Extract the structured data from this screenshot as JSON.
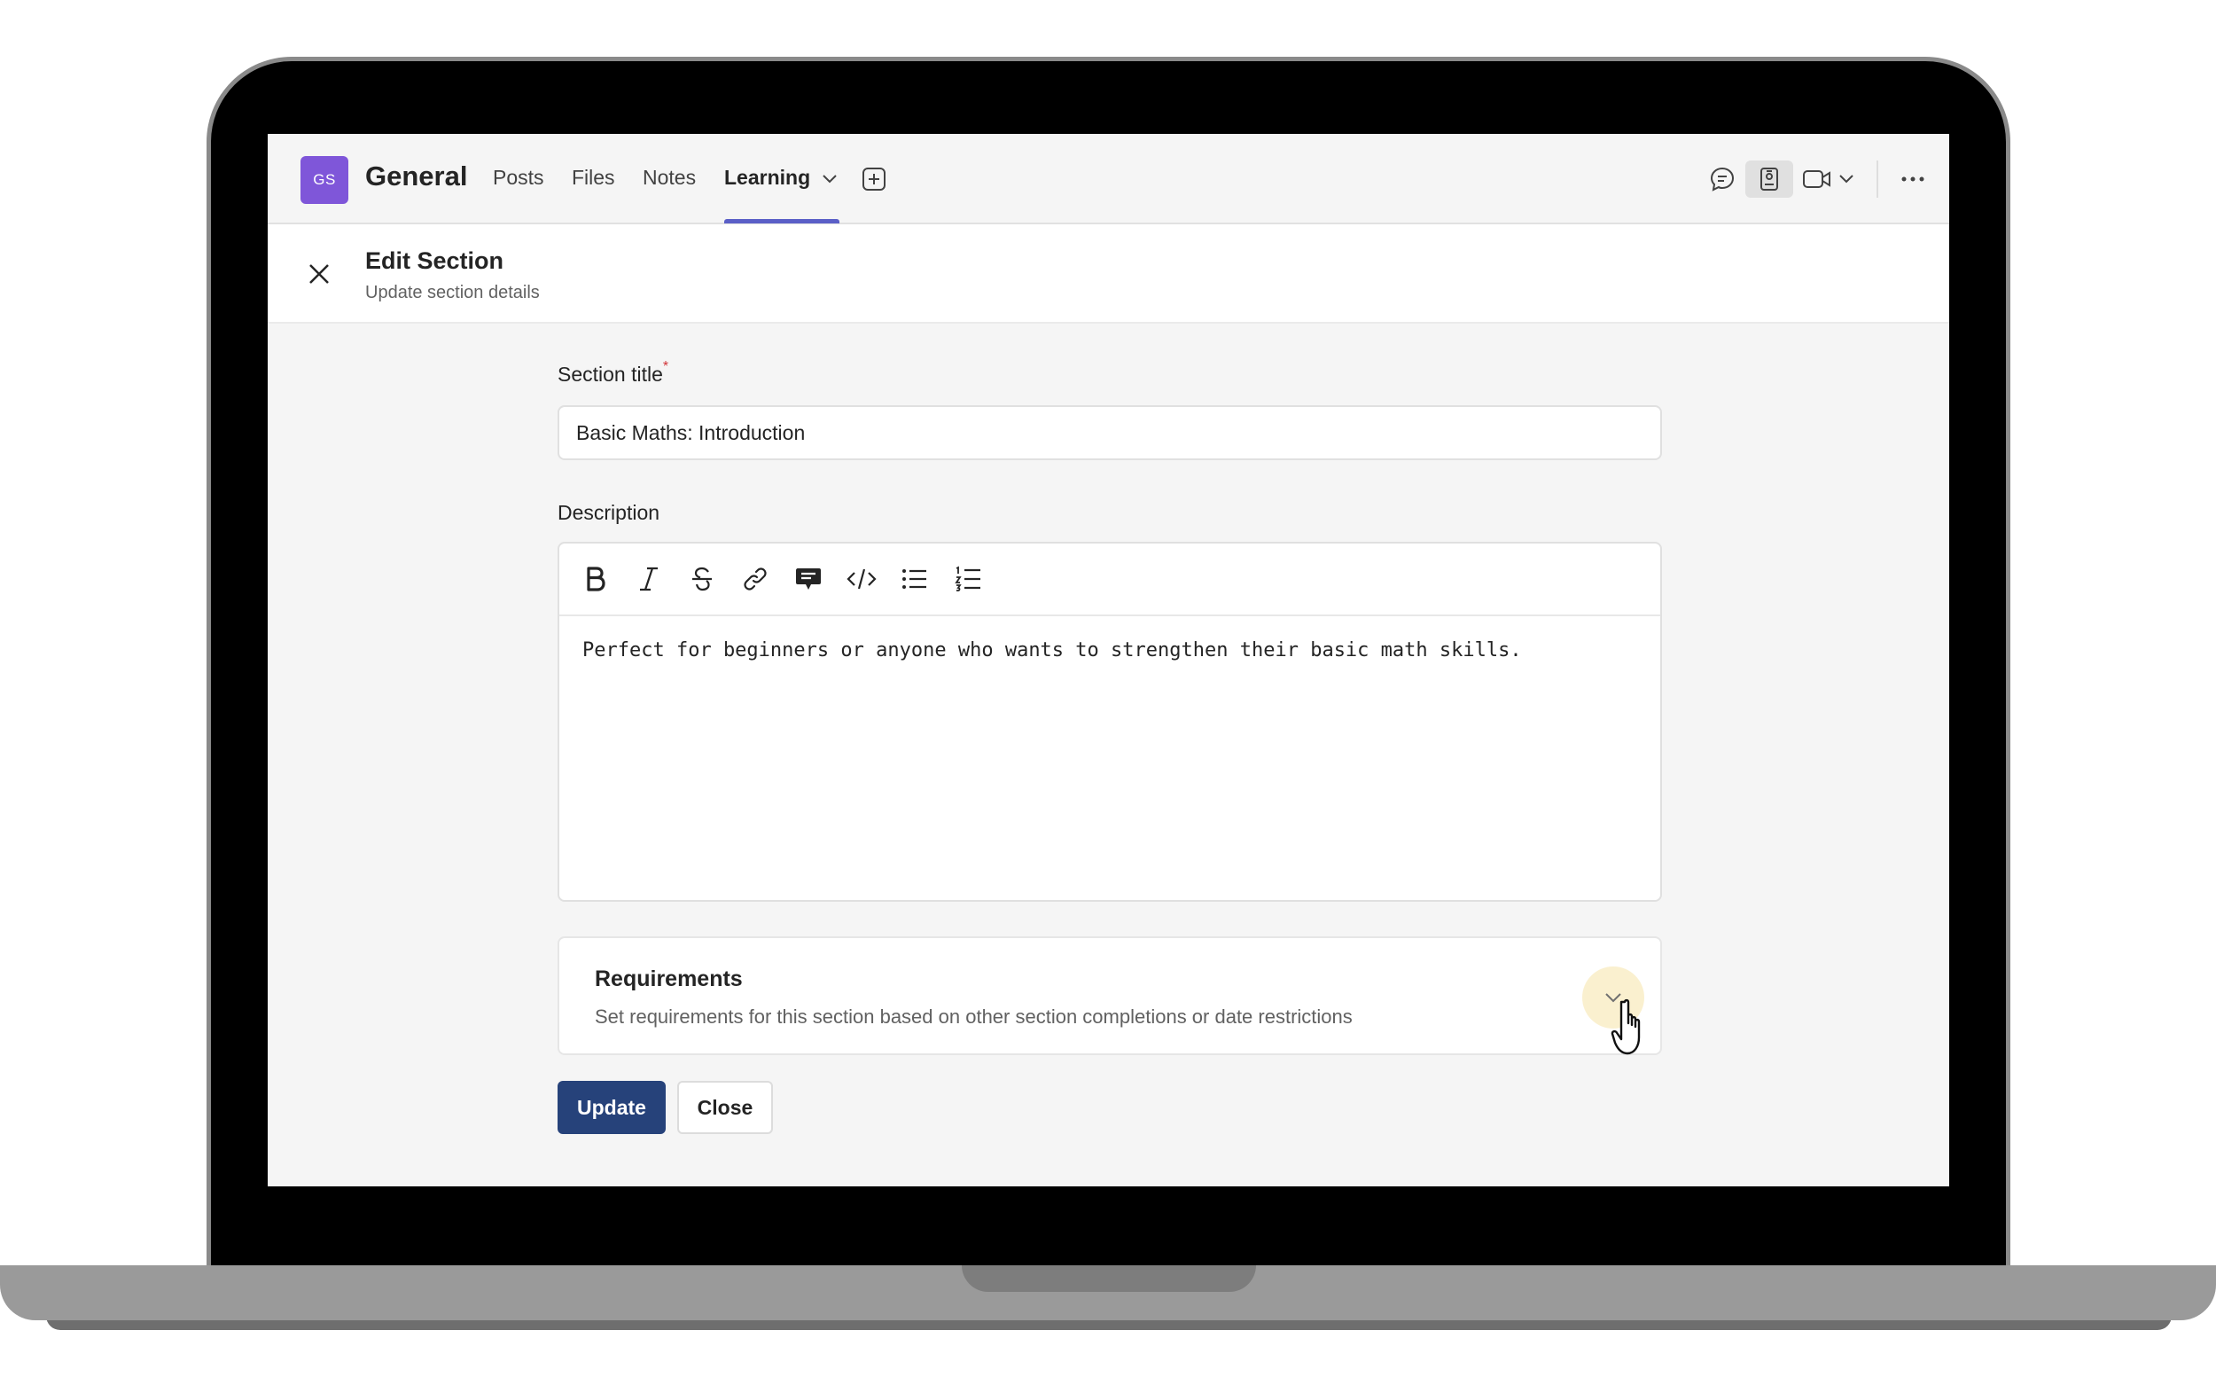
{
  "team": {
    "avatar_initials": "GS",
    "name": "General",
    "avatar_color": "#7f56d9"
  },
  "nav": {
    "tabs": [
      {
        "label": "Posts"
      },
      {
        "label": "Files"
      },
      {
        "label": "Notes"
      },
      {
        "label": "Learning",
        "active": true
      }
    ],
    "accent": "#5b5fc7",
    "icons": [
      "chevron-down-icon",
      "add-tab-icon",
      "chat-icon",
      "meeting-notes-icon",
      "video-call-icon",
      "chevron-down-icon",
      "more-options-icon"
    ]
  },
  "edit_header": {
    "title": "Edit Section",
    "subtitle": "Update section details",
    "close_icon": "close-icon"
  },
  "form": {
    "section_title_label": "Section title",
    "required_marker": "*",
    "section_title_value": "Basic Maths: Introduction",
    "description_label": "Description",
    "toolbar": [
      "bold-icon",
      "italic-icon",
      "strikethrough-icon",
      "link-icon",
      "comment-icon",
      "code-icon",
      "bullet-list-icon",
      "numbered-list-icon"
    ],
    "description_value": "Perfect for beginners or anyone who wants to strengthen their basic math skills."
  },
  "requirements": {
    "title": "Requirements",
    "description": "Set requirements for this section based on other section completions or date restrictions",
    "expanded": false
  },
  "actions": {
    "update_label": "Update",
    "close_label": "Close",
    "primary_color": "#26427a"
  }
}
